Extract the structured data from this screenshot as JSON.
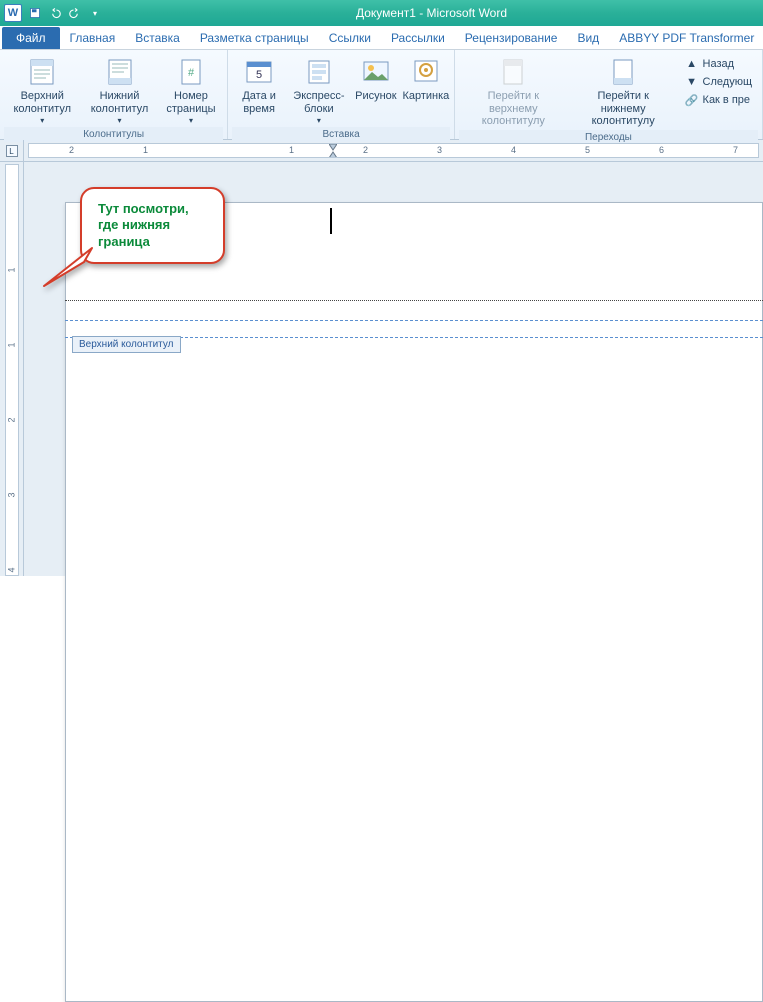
{
  "title": "Документ1 - Microsoft Word",
  "app_icon_letter": "W",
  "file_tab": "Файл",
  "tabs": [
    "Главная",
    "Вставка",
    "Разметка страницы",
    "Ссылки",
    "Рассылки",
    "Рецензирование",
    "Вид",
    "ABBYY PDF Transformer"
  ],
  "ribbon": {
    "headers_footers": {
      "label": "Колонтитулы",
      "header": "Верхний колонтитул",
      "footer": "Нижний колонтитул",
      "pagenum": "Номер страницы"
    },
    "insert": {
      "label": "Вставка",
      "datetime": "Дата и время",
      "quickparts": "Экспресс-блоки",
      "picture": "Рисунок",
      "clipart": "Картинка"
    },
    "nav": {
      "label": "Переходы",
      "goto_header": "Перейти к верхнему колонтитулу",
      "goto_footer": "Перейти к нижнему колонтитулу",
      "back": "Назад",
      "next": "Следующ",
      "link_prev": "Как в пре"
    }
  },
  "header_tag": "Верхний колонтитул",
  "callout_text": "Тут посмотри, где нижняя граница",
  "ruler_numbers": [
    "2",
    "1",
    "1",
    "2",
    "3",
    "4",
    "5",
    "6",
    "7"
  ]
}
